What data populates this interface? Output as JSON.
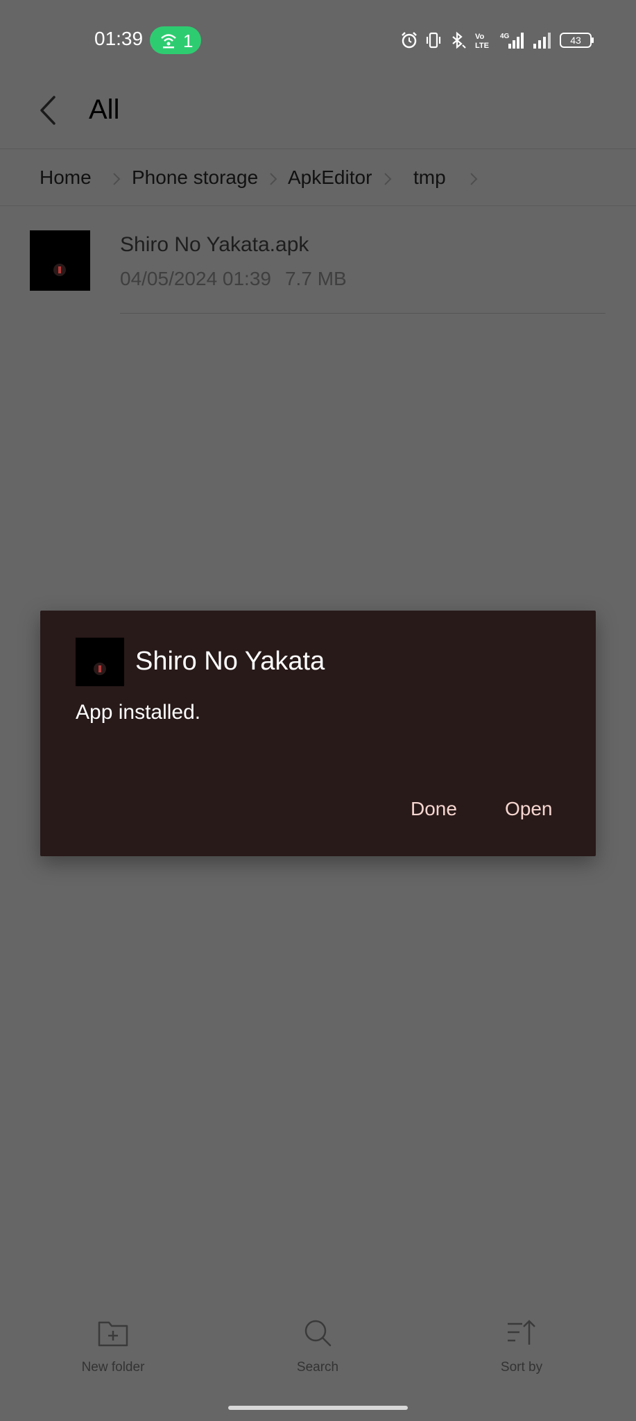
{
  "status_bar": {
    "time": "01:39",
    "hotspot_count": "1",
    "battery": "43"
  },
  "header": {
    "title": "All"
  },
  "breadcrumb": {
    "items": [
      "Home",
      "Phone storage",
      "ApkEditor",
      "tmp"
    ]
  },
  "file": {
    "name": "Shiro No Yakata.apk",
    "date": "04/05/2024 01:39",
    "size": "7.7 MB"
  },
  "dialog": {
    "title": "Shiro No Yakata",
    "message": "App installed.",
    "done_label": "Done",
    "open_label": "Open"
  },
  "bottom_bar": {
    "new_folder": "New folder",
    "search": "Search",
    "sort_by": "Sort by"
  },
  "colors": {
    "scrim": "#666666",
    "dialog_bg": "#281a19",
    "dialog_button": "#f6d6d0",
    "hotspot": "#2ecc71"
  },
  "icons": [
    "back-arrow-icon",
    "chevron-right-icon",
    "alarm-icon",
    "vibrate-icon",
    "bluetooth-icon",
    "volte-icon",
    "signal-icon",
    "battery-icon",
    "hotspot-icon",
    "new-folder-icon",
    "search-icon",
    "sort-icon"
  ]
}
